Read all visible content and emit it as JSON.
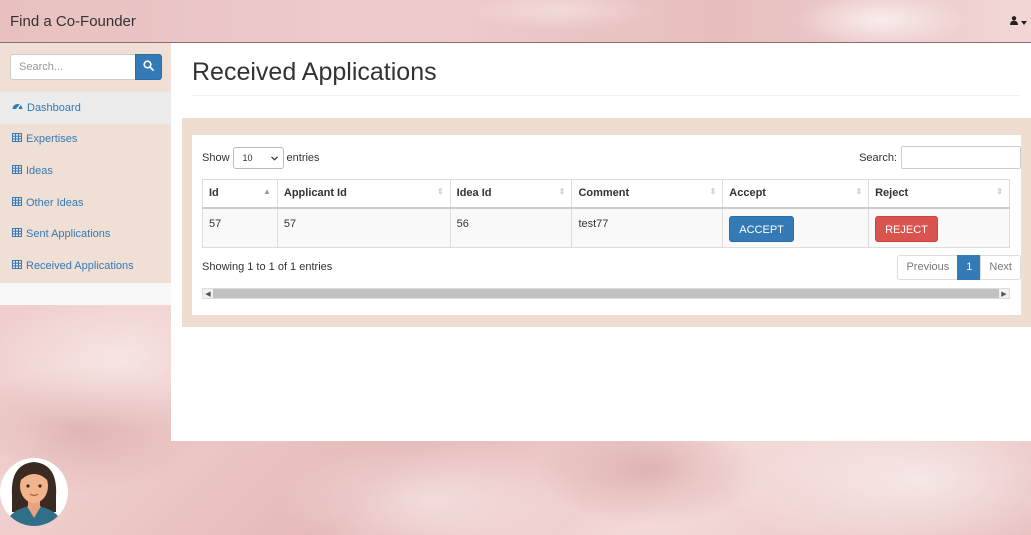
{
  "topbar": {
    "brand": "Find a Co-Founder",
    "user_icon": "user-icon",
    "caret_icon": "caret-down-icon"
  },
  "sidebar": {
    "search_placeholder": "Search...",
    "items": [
      {
        "label": "Dashboard",
        "icon": "dashboard-icon"
      },
      {
        "label": "Expertises",
        "icon": "table-icon"
      },
      {
        "label": "Ideas",
        "icon": "table-icon"
      },
      {
        "label": "Other Ideas",
        "icon": "table-icon"
      },
      {
        "label": "Sent Applications",
        "icon": "table-icon"
      },
      {
        "label": "Received Applications",
        "icon": "table-icon"
      }
    ]
  },
  "main": {
    "title": "Received Applications",
    "length": {
      "show": "Show",
      "value": "10",
      "entries": "entries"
    },
    "filter": {
      "label": "Search:"
    },
    "table": {
      "headers": [
        "Id",
        "Applicant Id",
        "Idea Id",
        "Comment",
        "Accept",
        "Reject"
      ],
      "rows": [
        {
          "id": "57",
          "applicant_id": "57",
          "idea_id": "56",
          "comment": "test77",
          "accept": "ACCEPT",
          "reject": "REJECT"
        }
      ]
    },
    "info": "Showing 1 to 1 of 1 entries",
    "pagination": {
      "previous": "Previous",
      "current": "1",
      "next": "Next"
    }
  },
  "colors": {
    "primary": "#337ab7",
    "danger": "#d9534f",
    "panel": "#efddd2",
    "sidebar": "#f0dfd4"
  }
}
